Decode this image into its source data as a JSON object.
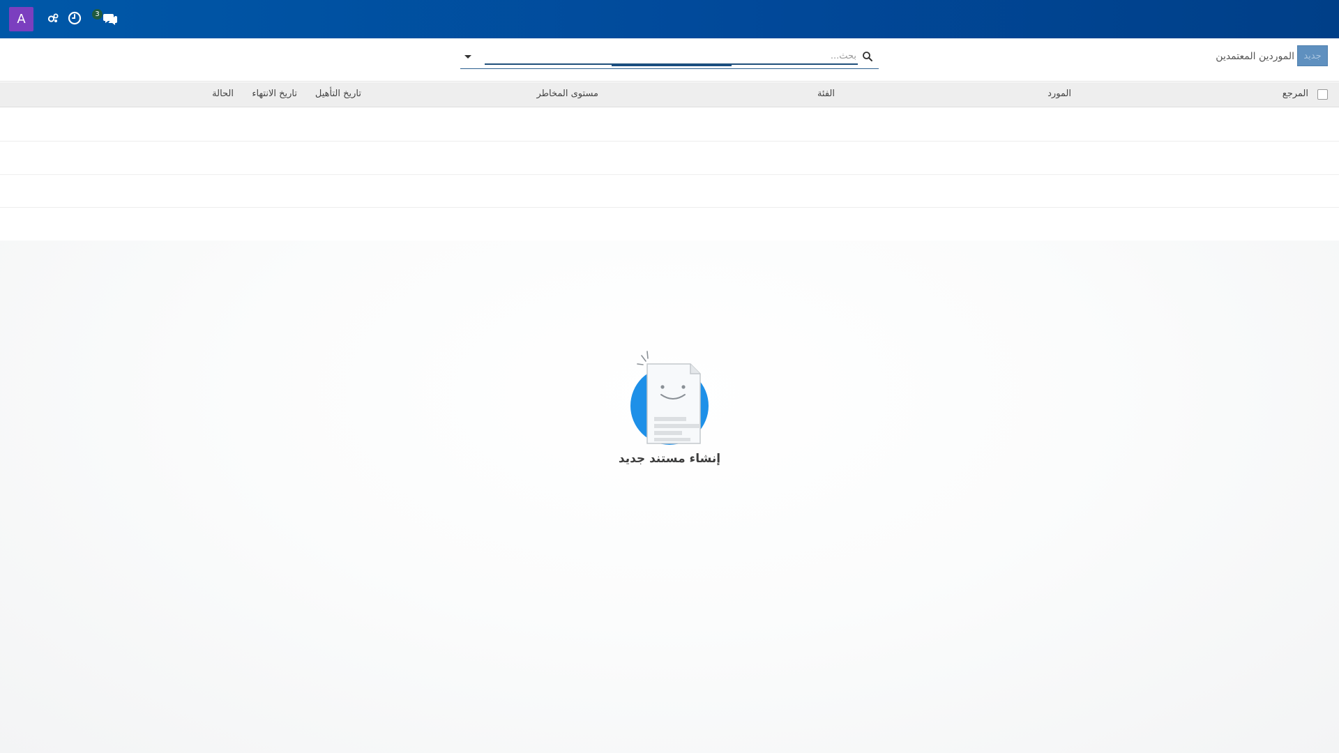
{
  "navbar": {
    "avatar_letter": "A",
    "avatar_color": "#7b3fbf",
    "background_color": "#0058a8",
    "messages_badge": "3",
    "icons": [
      "activities-icon",
      "clock-icon",
      "chat-icon"
    ]
  },
  "control_panel": {
    "new_button_label": "جديد",
    "breadcrumb": "الموردين المعتمدين",
    "search_placeholder": "بحث..."
  },
  "table": {
    "columns": [
      "المرجع",
      "المورد",
      "الفئة",
      "مستوى المخاطر",
      "تاريخ التأهيل",
      "تاريخ الانتهاء",
      "الحالة"
    ],
    "rows": []
  },
  "empty_state": {
    "title": "إنشاء مستند جديد",
    "accent_color": "#1e90e8"
  }
}
